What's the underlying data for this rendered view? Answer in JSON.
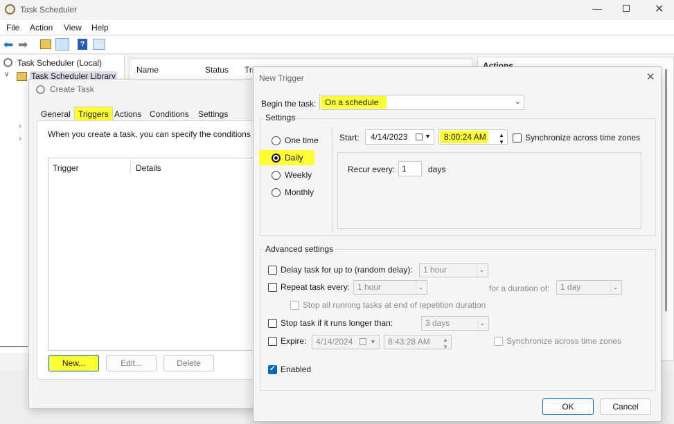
{
  "main_window": {
    "title": "Task Scheduler",
    "menu": [
      "File",
      "Action",
      "View",
      "Help"
    ],
    "tree": {
      "root": "Task Scheduler (Local)",
      "library": "Task Scheduler Library"
    },
    "list_headers": {
      "name": "Name",
      "status": "Status",
      "triggers": "Tri"
    },
    "actions_header": "Actions"
  },
  "create_task": {
    "title": "Create Task",
    "tabs": [
      "General",
      "Triggers",
      "Actions",
      "Conditions",
      "Settings"
    ],
    "description": "When you create a task, you can specify the conditions t",
    "table_headers": {
      "trigger": "Trigger",
      "details": "Details"
    },
    "buttons": {
      "new": "New...",
      "edit": "Edit...",
      "delete": "Delete"
    }
  },
  "new_trigger": {
    "title": "New Trigger",
    "begin_label": "Begin the task:",
    "begin_value": "On a schedule",
    "settings_label": "Settings",
    "schedule_options": [
      "One time",
      "Daily",
      "Weekly",
      "Monthly"
    ],
    "selected_option": "Daily",
    "start_label": "Start:",
    "start_date": "4/14/2023",
    "start_time": "8:00:24 AM",
    "sync_label": "Synchronize across time zones",
    "recur_label": "Recur every:",
    "recur_value": "1",
    "recur_unit": "days",
    "advanced_label": "Advanced settings",
    "delay_label": "Delay task for up to (random delay):",
    "delay_value": "1 hour",
    "repeat_label": "Repeat task every:",
    "repeat_value": "1 hour",
    "duration_label": "for a duration of:",
    "duration_value": "1 day",
    "stop_all_label": "Stop all running tasks at end of repetition duration",
    "stop_if_label": "Stop task if it runs longer than:",
    "stop_if_value": "3 days",
    "expire_label": "Expire:",
    "expire_date": "4/14/2024",
    "expire_time": "8:43:28 AM",
    "expire_sync_label": "Synchronize across time zones",
    "enabled_label": "Enabled",
    "ok": "OK",
    "cancel": "Cancel"
  },
  "colors": {
    "highlight": "#ffff33",
    "accent": "#0067c0"
  }
}
